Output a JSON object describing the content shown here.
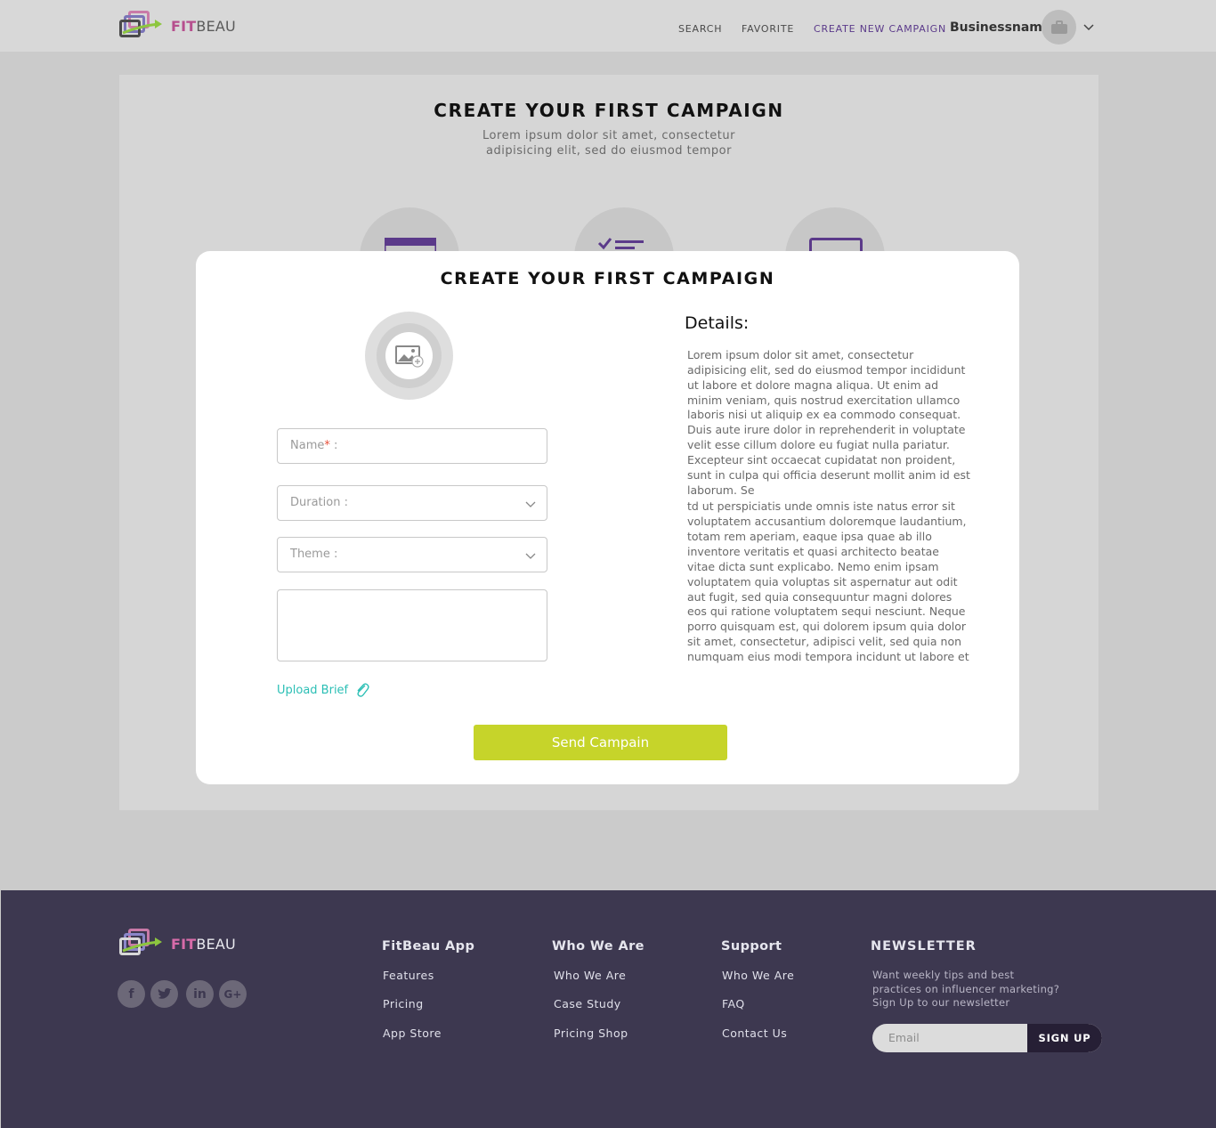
{
  "brand": {
    "fit": "FIT",
    "beau": "BEAU"
  },
  "nav": {
    "search": "SEARCH",
    "favorite": "FAVORITE",
    "create": "CREATE NEW CAMPAIGN",
    "business": "Businessname"
  },
  "background": {
    "title": "CREATE YOUR FIRST CAMPAIGN",
    "subtitle": "Lorem ipsum dolor sit amet, consectetur adipisicing elit, sed do eiusmod tempor"
  },
  "modal": {
    "title": "CREATE YOUR FIRST CAMPAIGN",
    "name_label": "Name",
    "name_req": "*",
    "name_suffix": " :",
    "duration_label": "Duration :",
    "theme_label": "Theme :",
    "upload_brief": "Upload Brief",
    "details_title": "Details:",
    "details_p1": "Lorem ipsum dolor sit amet, consectetur adipisicing elit, sed do eiusmod tempor incididunt ut labore et dolore magna aliqua. Ut enim ad minim veniam, quis nostrud exercitation ullamco laboris nisi ut aliquip ex ea commodo consequat. Duis aute irure dolor in reprehenderit in voluptate velit esse cillum dolore eu fugiat nulla pariatur. Excepteur sint occaecat cupidatat non proident, sunt in culpa qui officia deserunt mollit anim id est laborum. Se",
    "details_p2": "td ut perspiciatis unde omnis iste natus error sit voluptatem accusantium doloremque laudantium, totam rem aperiam, eaque ipsa quae ab illo inventore veritatis et quasi architecto beatae vitae dicta sunt explicabo. Nemo enim ipsam voluptatem quia voluptas sit aspernatur aut odit aut fugit, sed quia consequuntur magni dolores eos qui ratione voluptatem sequi nesciunt. Neque porro quisquam est, qui dolorem ipsum quia dolor sit amet, consectetur, adipisci velit, sed quia non numquam eius modi tempora incidunt ut labore et",
    "send": "Send Campain"
  },
  "footer": {
    "cols": [
      {
        "title": "FitBeau App",
        "links": [
          "Features",
          "Pricing",
          "App Store"
        ]
      },
      {
        "title": "Who We Are",
        "links": [
          "Who We Are",
          "Case Study",
          "Pricing Shop"
        ]
      },
      {
        "title": "Support",
        "links": [
          "Who We Are",
          "FAQ",
          "Contact Us"
        ]
      }
    ],
    "newsletter": {
      "title": "NEWSLETTER",
      "text": "Want weekly tips and best practices on influencer marketing?Sign Up to our newsletter",
      "placeholder": "Email",
      "button": "SIGN UP"
    },
    "social": [
      "facebook-icon",
      "twitter-icon",
      "linkedin-icon",
      "google-plus-icon"
    ]
  },
  "colors": {
    "accent": "#5b3a8a",
    "brand_pink": "#b64f8e",
    "button_green": "#c6d42a",
    "link_teal": "#2bbfb5",
    "footer_bg": "#3d3850"
  }
}
